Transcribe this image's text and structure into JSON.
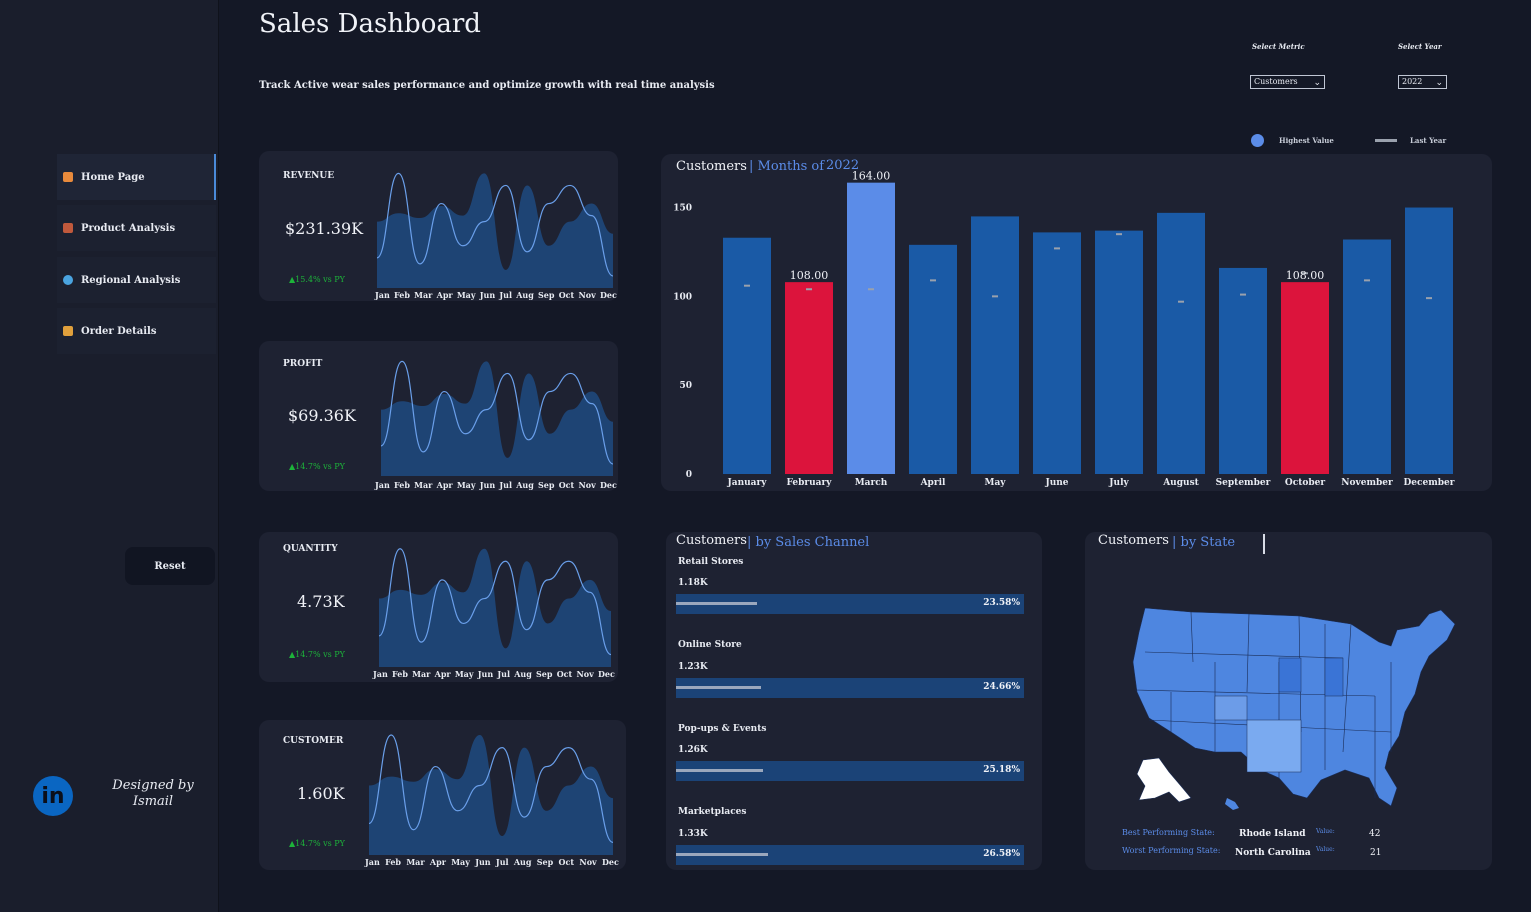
{
  "header": {
    "title": "Sales Dashboard",
    "subtitle": "Track Active wear sales performance and optimize growth with real time analysis"
  },
  "filters": {
    "metric_label": "Select Metric",
    "metric_value": "Customers",
    "year_label": "Select Year",
    "year_value": "2022"
  },
  "legend": {
    "highest": "Highest Value",
    "last_year": "Last Year"
  },
  "nav": {
    "items": [
      {
        "label": "Home Page",
        "icon": "home-icon"
      },
      {
        "label": "Product Analysis",
        "icon": "factory-icon"
      },
      {
        "label": "Regional Analysis",
        "icon": "globe-icon"
      },
      {
        "label": "Order Details",
        "icon": "box-icon"
      }
    ],
    "reset": "Reset"
  },
  "footer": {
    "designed_by": "Designed by",
    "author": "Ismail",
    "linkedin": "in"
  },
  "months_short": [
    "Jan",
    "Feb",
    "Mar",
    "Apr",
    "May",
    "Jun",
    "Jul",
    "Aug",
    "Sep",
    "Oct",
    "Nov",
    "Dec"
  ],
  "kpis": [
    {
      "label": "REVENUE",
      "value": "$231.39K",
      "delta": "▲15.4% vs PY"
    },
    {
      "label": "PROFIT",
      "value": "$69.36K",
      "delta": "▲14.7% vs PY"
    },
    {
      "label": "QUANTITY",
      "value": "4.73K",
      "delta": "▲14.7% vs PY"
    },
    {
      "label": "CUSTOMER",
      "value": "1.60K",
      "delta": "▲14.7% vs PY"
    }
  ],
  "monthly": {
    "title": "Customers",
    "sub_prefix": "| Months of",
    "year": "2022"
  },
  "channel": {
    "title": "Customers",
    "sub": "| by Sales Channel",
    "items": [
      {
        "name": "Retail Stores",
        "value": "1.18K",
        "pct": "23.58%",
        "share": 23.58
      },
      {
        "name": "Online Store",
        "value": "1.23K",
        "pct": "24.66%",
        "share": 24.66
      },
      {
        "name": "Pop-ups & Events",
        "value": "1.26K",
        "pct": "25.18%",
        "share": 25.18
      },
      {
        "name": "Marketplaces",
        "value": "1.33K",
        "pct": "26.58%",
        "share": 26.58
      }
    ]
  },
  "state": {
    "title": "Customers",
    "sub": "| by State",
    "best_label": "Best Performing State:",
    "best_state": "Rhode Island",
    "best_value": "42",
    "worst_label": "Worst Performing State:",
    "worst_state": "North Carolina",
    "worst_value": "21",
    "value_label": "Value:"
  },
  "chart_data": {
    "type": "bar",
    "categories": [
      "January",
      "February",
      "March",
      "April",
      "May",
      "June",
      "July",
      "August",
      "September",
      "October",
      "November",
      "December"
    ],
    "values": [
      133,
      108,
      164,
      129,
      145,
      136,
      137,
      147,
      116,
      108,
      132,
      150
    ],
    "last_year": [
      106,
      104,
      104,
      109,
      100,
      127,
      135,
      97,
      101,
      113,
      109,
      99
    ],
    "data_labels": {
      "February": "108.00",
      "March": "164.00",
      "October": "108.00"
    },
    "highlight": {
      "max": "March",
      "min": [
        "February",
        "October"
      ]
    },
    "colors": {
      "default": "#1a5aa6",
      "max": "#5b8ce8",
      "min": "#dc143c",
      "last_year": "#9aa1ad"
    },
    "yticks": [
      0,
      50,
      100,
      150
    ],
    "ylim": [
      0,
      170
    ]
  }
}
